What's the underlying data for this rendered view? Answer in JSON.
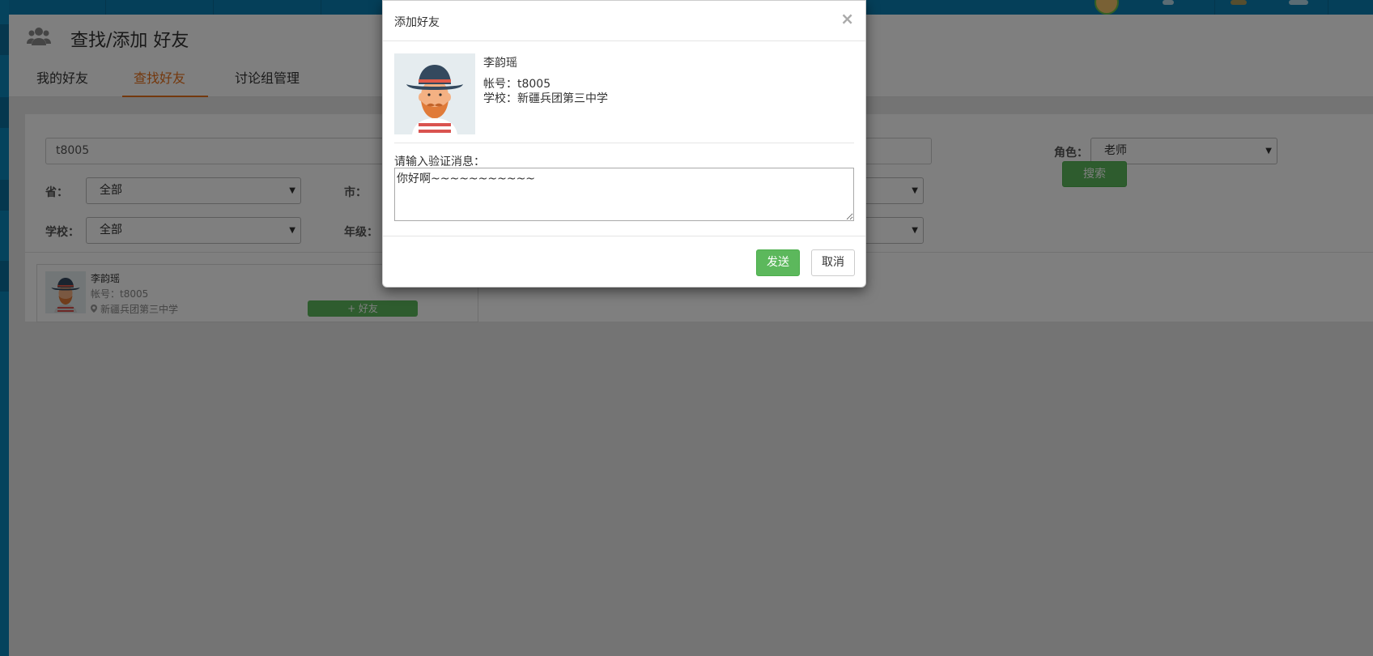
{
  "page": {
    "title": "查找/添加 好友",
    "tabs": [
      {
        "label": "我的好友",
        "active": false
      },
      {
        "label": "查找好友",
        "active": true
      },
      {
        "label": "讨论组管理",
        "active": false
      }
    ]
  },
  "search": {
    "keyword_value": "t8005",
    "role_label": "角色：",
    "role_value": "老师",
    "province_label": "省：",
    "province_value": "全部",
    "city_label": "市：",
    "school_label": "学校：",
    "school_value": "全部",
    "grade_label": "年级：",
    "search_button": "搜索"
  },
  "result_card": {
    "name": "李韵瑶",
    "account": "帐号：t8005",
    "school": "新疆兵团第三中学",
    "add_button": "+ 好友"
  },
  "modal": {
    "title": "添加好友",
    "close": "×",
    "name": "李韵瑶",
    "account": "帐号：t8005",
    "school": "学校：新疆兵团第三中学",
    "message_label": "请输入验证消息：",
    "message_value": "你好啊~~~~~~~~~~~",
    "send_button": "发送",
    "cancel_button": "取消"
  },
  "colors": {
    "topbar": "#0a7fb2",
    "accent_tab": "#e8701a",
    "success": "#5cb85c"
  },
  "icons": [
    "users-icon",
    "location-pin-icon",
    "close-icon",
    "chevron-down-icon"
  ]
}
